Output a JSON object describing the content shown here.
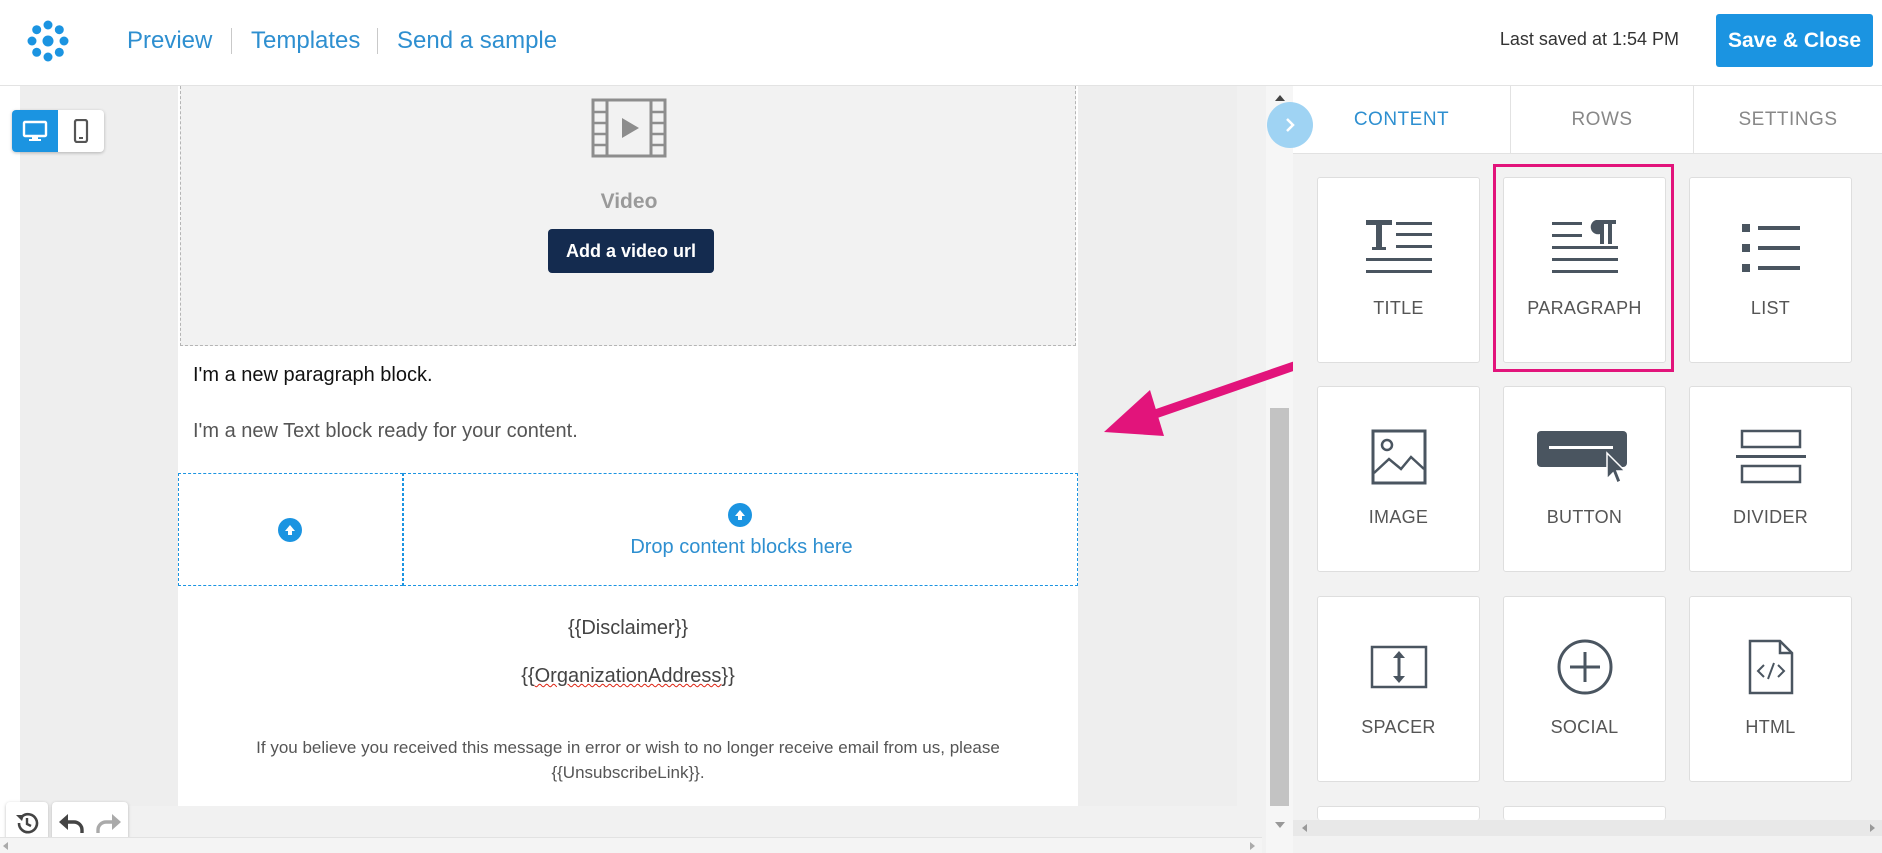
{
  "topbar": {
    "nav": [
      "Preview",
      "Templates",
      "Send a sample"
    ],
    "saved_text": "Last saved at 1:54 PM",
    "save_close_label": "Save & Close"
  },
  "editor": {
    "video": {
      "label": "Video",
      "button": "Add a video url"
    },
    "paragraph_1": "I'm a new paragraph block.",
    "paragraph_2": "I'm a new Text block ready for your content.",
    "drop_text": "Drop content blocks here",
    "disclaimer": "{{Disclaimer}}",
    "org_address_prefix": "{{",
    "org_address_word": "OrganizationAddress",
    "org_address_suffix": "}}",
    "unsubscribe_text": "If you believe you received this message in error or wish to no longer receive email from us, please {{UnsubscribeLink}}."
  },
  "sidebar": {
    "tabs": [
      "CONTENT",
      "ROWS",
      "SETTINGS"
    ],
    "active_tab": "CONTENT",
    "tiles": [
      {
        "label": "TITLE",
        "icon": "title-icon"
      },
      {
        "label": "PARAGRAPH",
        "icon": "paragraph-icon"
      },
      {
        "label": "LIST",
        "icon": "list-icon"
      },
      {
        "label": "IMAGE",
        "icon": "image-icon"
      },
      {
        "label": "BUTTON",
        "icon": "button-icon"
      },
      {
        "label": "DIVIDER",
        "icon": "divider-icon"
      },
      {
        "label": "SPACER",
        "icon": "spacer-icon"
      },
      {
        "label": "SOCIAL",
        "icon": "social-icon"
      },
      {
        "label": "HTML",
        "icon": "html-icon"
      }
    ]
  },
  "colors": {
    "accent": "#1b94e1",
    "dark_button": "#142b4f",
    "highlight": "#e2147b"
  }
}
